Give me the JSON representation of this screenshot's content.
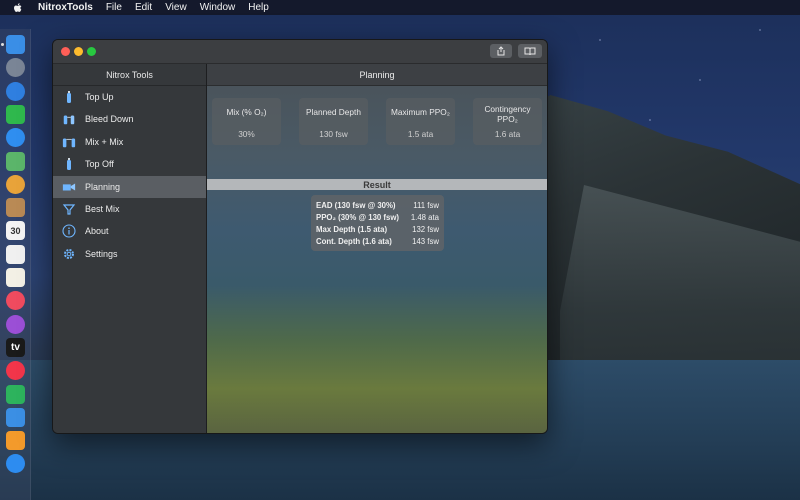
{
  "menubar": {
    "app": "NitroxTools",
    "items": [
      "File",
      "Edit",
      "View",
      "Window",
      "Help"
    ]
  },
  "window": {
    "sidebar_title": "Nitrox Tools",
    "main_title": "Planning"
  },
  "sidebar": {
    "items": [
      {
        "label": "Top Up",
        "icon": "tank-up-icon",
        "selected": false
      },
      {
        "label": "Bleed Down",
        "icon": "tank-bleed-icon",
        "selected": false
      },
      {
        "label": "Mix + Mix",
        "icon": "mix-tanks-icon",
        "selected": false
      },
      {
        "label": "Top Off",
        "icon": "tank-top-off-icon",
        "selected": false
      },
      {
        "label": "Planning",
        "icon": "planning-icon",
        "selected": true
      },
      {
        "label": "Best Mix",
        "icon": "best-mix-icon",
        "selected": false
      },
      {
        "label": "About",
        "icon": "info-icon",
        "selected": false
      },
      {
        "label": "Settings",
        "icon": "gear-icon",
        "selected": false
      }
    ]
  },
  "cards": [
    {
      "label": "Mix (% O₂)",
      "value": "30%"
    },
    {
      "label": "Planned Depth",
      "value": "130 fsw"
    },
    {
      "label": "Maximum PPO₂",
      "value": "1.5 ata"
    },
    {
      "label": "Contingency PPO₂",
      "value": "1.6 ata"
    }
  ],
  "result": {
    "title": "Result",
    "rows": [
      {
        "key": "EAD (130 fsw @ 30%)",
        "value": "111 fsw"
      },
      {
        "key": "PPO₂ (30% @ 130 fsw)",
        "value": "1.48 ata"
      },
      {
        "key": "Max Depth (1.5 ata)",
        "value": "132 fsw"
      },
      {
        "key": "Cont. Depth (1.6 ata)",
        "value": "143 fsw"
      }
    ]
  },
  "dock": {
    "apps": [
      {
        "name": "finder-icon",
        "color": "#3a8ee6"
      },
      {
        "name": "launchpad-icon",
        "color": "#7a8596"
      },
      {
        "name": "safari-icon",
        "color": "#2f7fe0"
      },
      {
        "name": "facetime-icon",
        "color": "#2fb84d"
      },
      {
        "name": "messages-icon",
        "color": "#2f8ef0"
      },
      {
        "name": "maps-icon",
        "color": "#5bb56a"
      },
      {
        "name": "photos-icon",
        "color": "#e8a33a"
      },
      {
        "name": "contacts-icon",
        "color": "#b98a55"
      },
      {
        "name": "calendar-icon",
        "color": "#f4f4f4",
        "text": "30"
      },
      {
        "name": "reminders-icon",
        "color": "#f0f0f0"
      },
      {
        "name": "notes-icon",
        "color": "#f3f0e5"
      },
      {
        "name": "music-icon",
        "color": "#f04b5f"
      },
      {
        "name": "podcasts-icon",
        "color": "#9b4fd6"
      },
      {
        "name": "tv-icon",
        "color": "#1a1a1a",
        "text": "tv"
      },
      {
        "name": "news-icon",
        "color": "#f2354a"
      },
      {
        "name": "numbers-icon",
        "color": "#2db35d"
      },
      {
        "name": "keynote-icon",
        "color": "#3b8fe4"
      },
      {
        "name": "pages-icon",
        "color": "#f39a2b"
      },
      {
        "name": "app-store-icon",
        "color": "#2d8cf0"
      }
    ]
  },
  "colors": {
    "selection": "#5a5e63",
    "sidebar": "#35383b",
    "red": "#ff5f57",
    "yellow": "#febc2e",
    "green": "#28c840"
  }
}
